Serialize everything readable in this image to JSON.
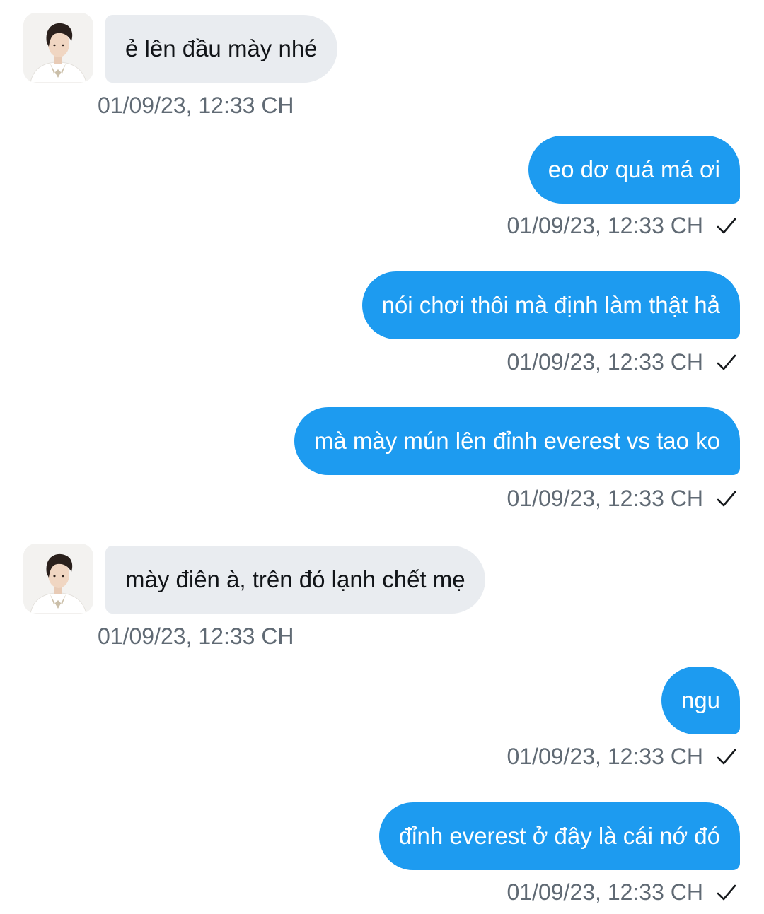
{
  "messages": [
    {
      "direction": "in",
      "text": "ẻ lên đầu mày nhé",
      "time": "01/09/23, 12:33 CH",
      "avatar_icon": "user-avatar"
    },
    {
      "direction": "out",
      "text": "eo dơ quá má ơi",
      "time": "01/09/23, 12:33 CH",
      "status_icon": "sent-check-icon"
    },
    {
      "direction": "out",
      "text": "nói chơi thôi mà định làm thật hả",
      "time": "01/09/23, 12:33 CH",
      "status_icon": "sent-check-icon"
    },
    {
      "direction": "out",
      "text": "mà mày mún lên đỉnh everest vs tao ko",
      "time": "01/09/23, 12:33 CH",
      "status_icon": "sent-check-icon"
    },
    {
      "direction": "in",
      "text": "mày điên à, trên đó lạnh chết mẹ",
      "time": "01/09/23, 12:33 CH",
      "avatar_icon": "user-avatar"
    },
    {
      "direction": "out",
      "text": "ngu",
      "time": "01/09/23, 12:33 CH",
      "status_icon": "sent-check-icon"
    },
    {
      "direction": "out",
      "text": "đỉnh everest ở đây là cái nớ đó",
      "time": "01/09/23, 12:33 CH",
      "status_icon": "sent-check-icon"
    }
  ],
  "colors": {
    "outgoing_bubble": "#1d9bf0",
    "incoming_bubble": "#e9ecf0",
    "timestamp": "#606a74"
  }
}
